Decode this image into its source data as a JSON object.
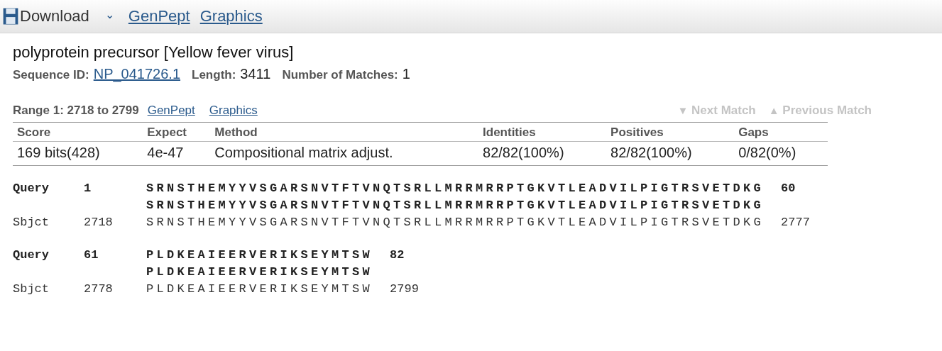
{
  "toolbar": {
    "download": "Download",
    "caret": "⌄",
    "links": [
      "GenPept",
      "Graphics"
    ]
  },
  "title": "polyprotein precursor [Yellow fever virus]",
  "summary": [
    {
      "label": "Sequence ID:",
      "value": "NP_041726.1",
      "kind": "link"
    },
    {
      "label": "Length:",
      "value": "3411",
      "kind": "text"
    },
    {
      "label": "Number of Matches:",
      "value": "1",
      "kind": "text"
    }
  ],
  "range": {
    "label": "Range 1: 2718 to 2799",
    "links": [
      "GenPept",
      "Graphics"
    ],
    "nav": [
      {
        "label": "Next Match",
        "arrow": "▼",
        "disabled": true
      },
      {
        "label": "Previous Match",
        "arrow": "▲",
        "disabled": true
      }
    ]
  },
  "table": {
    "columns": [
      "Score",
      "Expect",
      "Method",
      "Identities",
      "Positives",
      "Gaps"
    ],
    "rows": [
      [
        "169 bits(428)",
        "4e-47",
        "Compositional matrix adjust.",
        "82/82(100%)",
        "82/82(100%)",
        "0/82(0%)"
      ]
    ]
  },
  "alignment": [
    {
      "lines": [
        {
          "kind": "query",
          "label": "Query",
          "start": "1",
          "seq": "SRNSTHEMYYVSGARSNVTFTVNQTSRLLMRRMRRPTGKVTLEADVILPIGTRSVETDKG",
          "end": "60"
        },
        {
          "kind": "match",
          "seq": "SRNSTHEMYYVSGARSNVTFTVNQTSRLLMRRMRRPTGKVTLEADVILPIGTRSVETDKG"
        },
        {
          "kind": "sbjct",
          "label": "Sbjct",
          "start": "2718",
          "seq": "SRNSTHEMYYVSGARSNVTFTVNQTSRLLMRRMRRPTGKVTLEADVILPIGTRSVETDKG",
          "end": "2777"
        }
      ]
    },
    {
      "lines": [
        {
          "kind": "query",
          "label": "Query",
          "start": "61",
          "seq": "PLDKEAIEERVERIKSEYMTSW",
          "end": "82"
        },
        {
          "kind": "match",
          "seq": "PLDKEAIEERVERIKSEYMTSW"
        },
        {
          "kind": "sbjct",
          "label": "Sbjct",
          "start": "2778",
          "seq": "PLDKEAIEERVERIKSEYMTSW",
          "end": "2799"
        }
      ]
    }
  ]
}
